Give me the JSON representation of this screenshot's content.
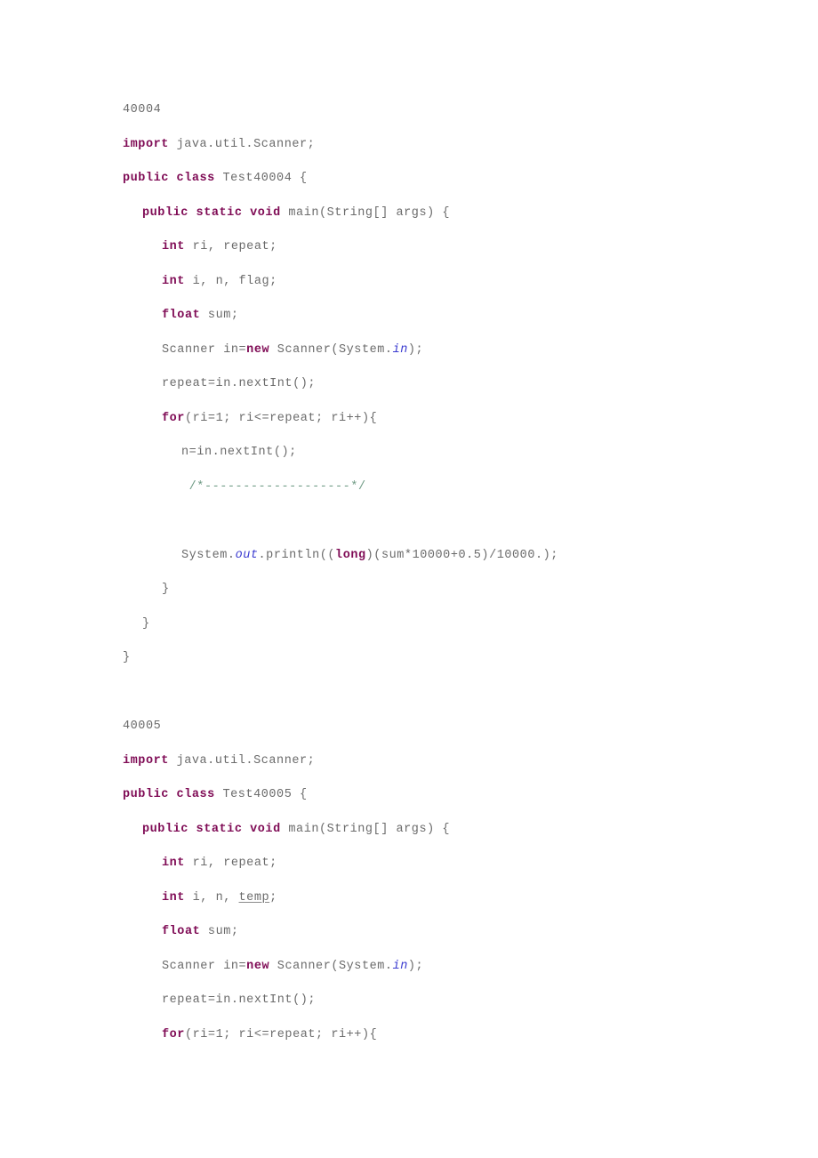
{
  "document": {
    "type": "java-source-listing",
    "colors": {
      "text": "#6b6b6b",
      "keyword": "#7f0b55",
      "field": "#3b3bd0",
      "comment": "#6f9b85",
      "background": "#ffffff"
    },
    "sections": [
      {
        "id": "40004",
        "heading": "40004",
        "lines": [
          {
            "kind": "code",
            "indent": 0,
            "tokens": [
              {
                "t": "kw",
                "v": "import"
              },
              {
                "t": "plain",
                "v": " java.util.Scanner;"
              }
            ]
          },
          {
            "kind": "code",
            "indent": 0,
            "tokens": [
              {
                "t": "kw",
                "v": "public class"
              },
              {
                "t": "plain",
                "v": " Test40004 {"
              }
            ]
          },
          {
            "kind": "code",
            "indent": 1,
            "tokens": [
              {
                "t": "kw",
                "v": "public static void"
              },
              {
                "t": "plain",
                "v": " main(String[] args) {"
              }
            ]
          },
          {
            "kind": "code",
            "indent": 2,
            "tokens": [
              {
                "t": "kw",
                "v": "int"
              },
              {
                "t": "plain",
                "v": " ri, repeat;"
              }
            ]
          },
          {
            "kind": "code",
            "indent": 2,
            "tokens": [
              {
                "t": "kw",
                "v": "int"
              },
              {
                "t": "plain",
                "v": " i, n, flag;"
              }
            ]
          },
          {
            "kind": "code",
            "indent": 2,
            "tokens": [
              {
                "t": "kw",
                "v": "float"
              },
              {
                "t": "plain",
                "v": " sum;"
              }
            ]
          },
          {
            "kind": "code",
            "indent": 2,
            "tokens": [
              {
                "t": "plain",
                "v": "Scanner in="
              },
              {
                "t": "kw",
                "v": "new"
              },
              {
                "t": "plain",
                "v": " Scanner(System."
              },
              {
                "t": "field",
                "v": "in"
              },
              {
                "t": "plain",
                "v": ");"
              }
            ]
          },
          {
            "kind": "code",
            "indent": 2,
            "tokens": [
              {
                "t": "plain",
                "v": "repeat=in.nextInt();"
              }
            ]
          },
          {
            "kind": "code",
            "indent": 2,
            "tokens": [
              {
                "t": "kw",
                "v": "for"
              },
              {
                "t": "plain",
                "v": "(ri=1; ri<=repeat; ri++){"
              }
            ]
          },
          {
            "kind": "code",
            "indent": 3,
            "tokens": [
              {
                "t": "plain",
                "v": "n=in.nextInt();"
              }
            ]
          },
          {
            "kind": "code",
            "indent": 3,
            "tokens": [
              {
                "t": "comment",
                "v": " /*-------------------*/"
              }
            ]
          },
          {
            "kind": "blank"
          },
          {
            "kind": "code",
            "indent": 3,
            "tokens": [
              {
                "t": "plain",
                "v": "System."
              },
              {
                "t": "field",
                "v": "out"
              },
              {
                "t": "plain",
                "v": ".println(("
              },
              {
                "t": "kw",
                "v": "long"
              },
              {
                "t": "plain",
                "v": ")(sum*10000+0.5)/10000.);"
              }
            ]
          },
          {
            "kind": "code",
            "indent": 2,
            "tokens": [
              {
                "t": "plain",
                "v": "}"
              }
            ]
          },
          {
            "kind": "code",
            "indent": 1,
            "tokens": [
              {
                "t": "plain",
                "v": "}"
              }
            ]
          },
          {
            "kind": "code",
            "indent": 0,
            "tokens": [
              {
                "t": "plain",
                "v": "}"
              }
            ]
          },
          {
            "kind": "blank"
          }
        ]
      },
      {
        "id": "40005",
        "heading": "40005",
        "lines": [
          {
            "kind": "code",
            "indent": 0,
            "tokens": [
              {
                "t": "kw",
                "v": "import"
              },
              {
                "t": "plain",
                "v": " java.util.Scanner;"
              }
            ]
          },
          {
            "kind": "code",
            "indent": 0,
            "tokens": [
              {
                "t": "kw",
                "v": "public class"
              },
              {
                "t": "plain",
                "v": " Test40005 {"
              }
            ]
          },
          {
            "kind": "code",
            "indent": 1,
            "tokens": [
              {
                "t": "kw",
                "v": "public static void"
              },
              {
                "t": "plain",
                "v": " main(String[] args) {"
              }
            ]
          },
          {
            "kind": "code",
            "indent": 2,
            "tokens": [
              {
                "t": "kw",
                "v": "int"
              },
              {
                "t": "plain",
                "v": " ri, repeat;"
              }
            ]
          },
          {
            "kind": "code",
            "indent": 2,
            "tokens": [
              {
                "t": "kw",
                "v": "int"
              },
              {
                "t": "plain",
                "v": " i, n, "
              },
              {
                "t": "spellerr",
                "v": "temp"
              },
              {
                "t": "plain",
                "v": ";"
              }
            ]
          },
          {
            "kind": "code",
            "indent": 2,
            "tokens": [
              {
                "t": "kw",
                "v": "float"
              },
              {
                "t": "plain",
                "v": " sum;"
              }
            ]
          },
          {
            "kind": "code",
            "indent": 2,
            "tokens": [
              {
                "t": "plain",
                "v": "Scanner in="
              },
              {
                "t": "kw",
                "v": "new"
              },
              {
                "t": "plain",
                "v": " Scanner(System."
              },
              {
                "t": "field",
                "v": "in"
              },
              {
                "t": "plain",
                "v": ");"
              }
            ]
          },
          {
            "kind": "code",
            "indent": 2,
            "tokens": [
              {
                "t": "plain",
                "v": "repeat=in.nextInt();"
              }
            ]
          },
          {
            "kind": "code",
            "indent": 2,
            "tokens": [
              {
                "t": "kw",
                "v": "for"
              },
              {
                "t": "plain",
                "v": "(ri=1; ri<=repeat; ri++){"
              }
            ]
          }
        ]
      }
    ]
  }
}
